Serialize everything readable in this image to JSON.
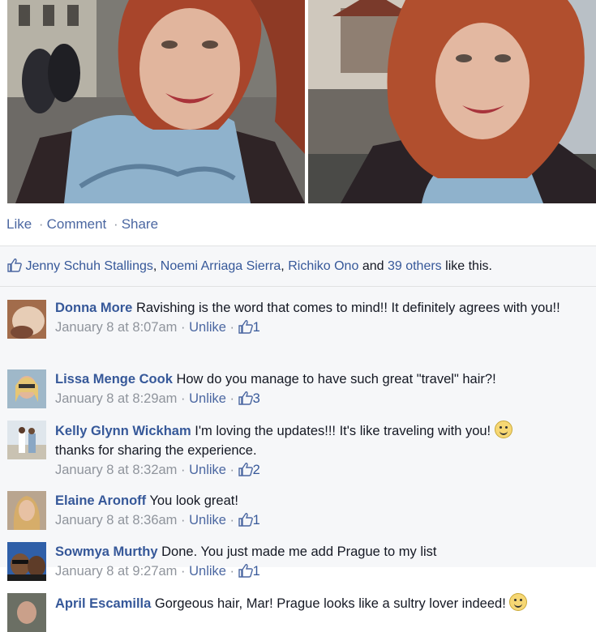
{
  "post": {
    "actions": {
      "like": "Like",
      "comment": "Comment",
      "share": "Share",
      "separator": "·"
    },
    "likes": {
      "names": [
        "Jenny Schuh Stallings",
        "Noemi Arriaga Sierra",
        "Richiko Ono"
      ],
      "sep1": ",",
      "sep2": ",",
      "and": "and",
      "others": "39 others",
      "tail": "like this."
    }
  },
  "comments": [
    {
      "author": "Donna More",
      "text": "Ravishing is the word that comes to mind!! It definitely agrees with you!!",
      "time": "January 8 at 8:07am",
      "unlike": "Unlike",
      "likes": "1"
    },
    {
      "author": "Lissa Menge Cook",
      "text": "How do you manage to have such great \"travel\" hair?!",
      "time": "January 8 at 8:29am",
      "unlike": "Unlike",
      "likes": "3"
    },
    {
      "author": "Kelly Glynn Wickham",
      "text": "I'm loving the updates!!! It's like traveling with you!",
      "text2": "thanks for sharing the experience.",
      "time": "January 8 at 8:32am",
      "unlike": "Unlike",
      "likes": "2"
    },
    {
      "author": "Elaine Aronoff",
      "text": "You look great!",
      "time": "January 8 at 8:36am",
      "unlike": "Unlike",
      "likes": "1"
    },
    {
      "author": "Sowmya Murthy",
      "text": "Done. You just made me add Prague to my list",
      "time": "January 8 at 9:27am",
      "unlike": "Unlike",
      "likes": "1"
    },
    {
      "author": "April Escamilla",
      "text": "Gorgeous hair, Mar! Prague looks like a sultry lover indeed!"
    }
  ],
  "icons": {
    "like_thumb": "thumbs-up-icon",
    "smiley": "smiley-emoji",
    "wink": "wink-emoji"
  },
  "colors": {
    "link": "#365899",
    "meta": "#8f949c",
    "background": "#f6f7f9"
  }
}
